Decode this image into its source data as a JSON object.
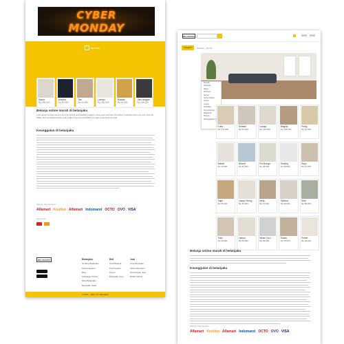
{
  "left": {
    "banner": {
      "line1": "CYBER",
      "line2": "MONDAY"
    },
    "section_label": "Ide Kado",
    "products": [
      {
        "name": "Kasur",
        "price": "Rp 189.000"
      },
      {
        "name": "Monitor",
        "price": "Rp 45.000"
      },
      {
        "name": "Tas",
        "price": "Rp 44.000"
      },
      {
        "name": "Lampu",
        "price": "Rp 250.000"
      },
      {
        "name": "Hiasan",
        "price": "Rp 54.000"
      },
      {
        "name": "Jam tangan",
        "price": "Rp 149.000"
      }
    ],
    "heading1": "Belanja online murah di belanjaku",
    "paragraph1": "Lorem ipsum is simply dummy text of the printing and typesetting industry. Lorem Ipsum has been the industry's standard dummy text ever since the 1500s, when an unknown printer took a galley of type and scrambled it to make a type specimen book.",
    "heading2": "Keunggulan di belanjaku",
    "payment_label": "Metode Pembayaran",
    "partner_label": "Jasa Kirim",
    "payments": [
      "Alfamart",
      "Kredivo",
      "Alfamart",
      "Indomaret",
      "OCTO",
      "OVO",
      "VISA"
    ],
    "footer": {
      "logo": "BELANJAKU",
      "col1": {
        "title": "Belanjaku",
        "items": [
          "Tentang Belanjaku",
          "Hak Kekayaan",
          "Blog",
          "Kebijakan Privasi",
          "Mitra Belanjaku",
          "Belanjaku Seller"
        ]
      },
      "col2": {
        "title": "Beli",
        "items": [
          "Cara Belanja",
          "Pembayaran",
          "Promo",
          "Belanjaku Care"
        ]
      },
      "col3": {
        "title": "Jual",
        "items": [
          "Cara Berjualan",
          "Seller Education",
          "Keuntungan Jual",
          "Daftar Official"
        ]
      },
      "copyright": "© 2021 - 2022, PT. Belanjaku"
    }
  },
  "right": {
    "logo": "BELANJAKU",
    "category_button": "Kategori",
    "breadcrumb": "Beranda > Rumah",
    "menu_items": [
      "Rumah",
      "Dekorasi",
      "Dapur",
      "Furniture",
      "Kamar",
      "Kamar Mandi",
      "Taman",
      "Lampu",
      "Perkakas",
      "Penyimpanan",
      "Elektronik",
      "Mainan",
      "Perlengkapan Kantor"
    ],
    "grid": [
      [
        {
          "name": "Kursi",
          "price": "Rp 179.000"
        },
        {
          "name": "Setelan",
          "price": "Rp 66.000"
        },
        {
          "name": "Lampu",
          "price": "Rp 125.000"
        },
        {
          "name": "Bingkai",
          "price": "Rp 145.000"
        },
        {
          "name": "Piring",
          "price": "Rp 31.000"
        }
      ],
      [
        {
          "name": "Bantal",
          "price": "Rp 30.000"
        },
        {
          "name": "Bersoli",
          "price": "Rp 49.000"
        },
        {
          "name": "Pot Bunga",
          "price": "Rp 58.000"
        },
        {
          "name": "Dinding",
          "price": "Rp 68.000"
        },
        {
          "name": "Sapu",
          "price": "Rp 14.000"
        }
      ],
      [
        {
          "name": "Sapu",
          "price": "Rp 56.000"
        },
        {
          "name": "Lampu Hiring",
          "price": "Rp 45.000"
        },
        {
          "name": "Meja",
          "price": "Rp 67.000"
        },
        {
          "name": "Selimut",
          "price": "Rp 16.000"
        },
        {
          "name": "Sets",
          "price": "Rp 88.000"
        }
      ],
      [
        {
          "name": "Sofa",
          "price": "Rp 45.000"
        },
        {
          "name": "Lampu",
          "price": "Rp 56.000"
        },
        {
          "name": "Mesin Cuci",
          "price": "Rp 94.000"
        },
        {
          "name": "Dasan",
          "price": "Rp 78.000"
        },
        {
          "name": "Poster",
          "price": "Rp 34.000"
        }
      ]
    ],
    "heading1": "Belanja online murah di belanjaku",
    "heading2": "Keunggulan di belanjaku",
    "payment_label": "Metode Pembayaran",
    "payments": [
      "Alfamart",
      "Kredivo",
      "Alfamart",
      "Indomaret",
      "OCTO",
      "OVO",
      "VISA"
    ]
  },
  "colors": {
    "accent": "#f5c400"
  }
}
